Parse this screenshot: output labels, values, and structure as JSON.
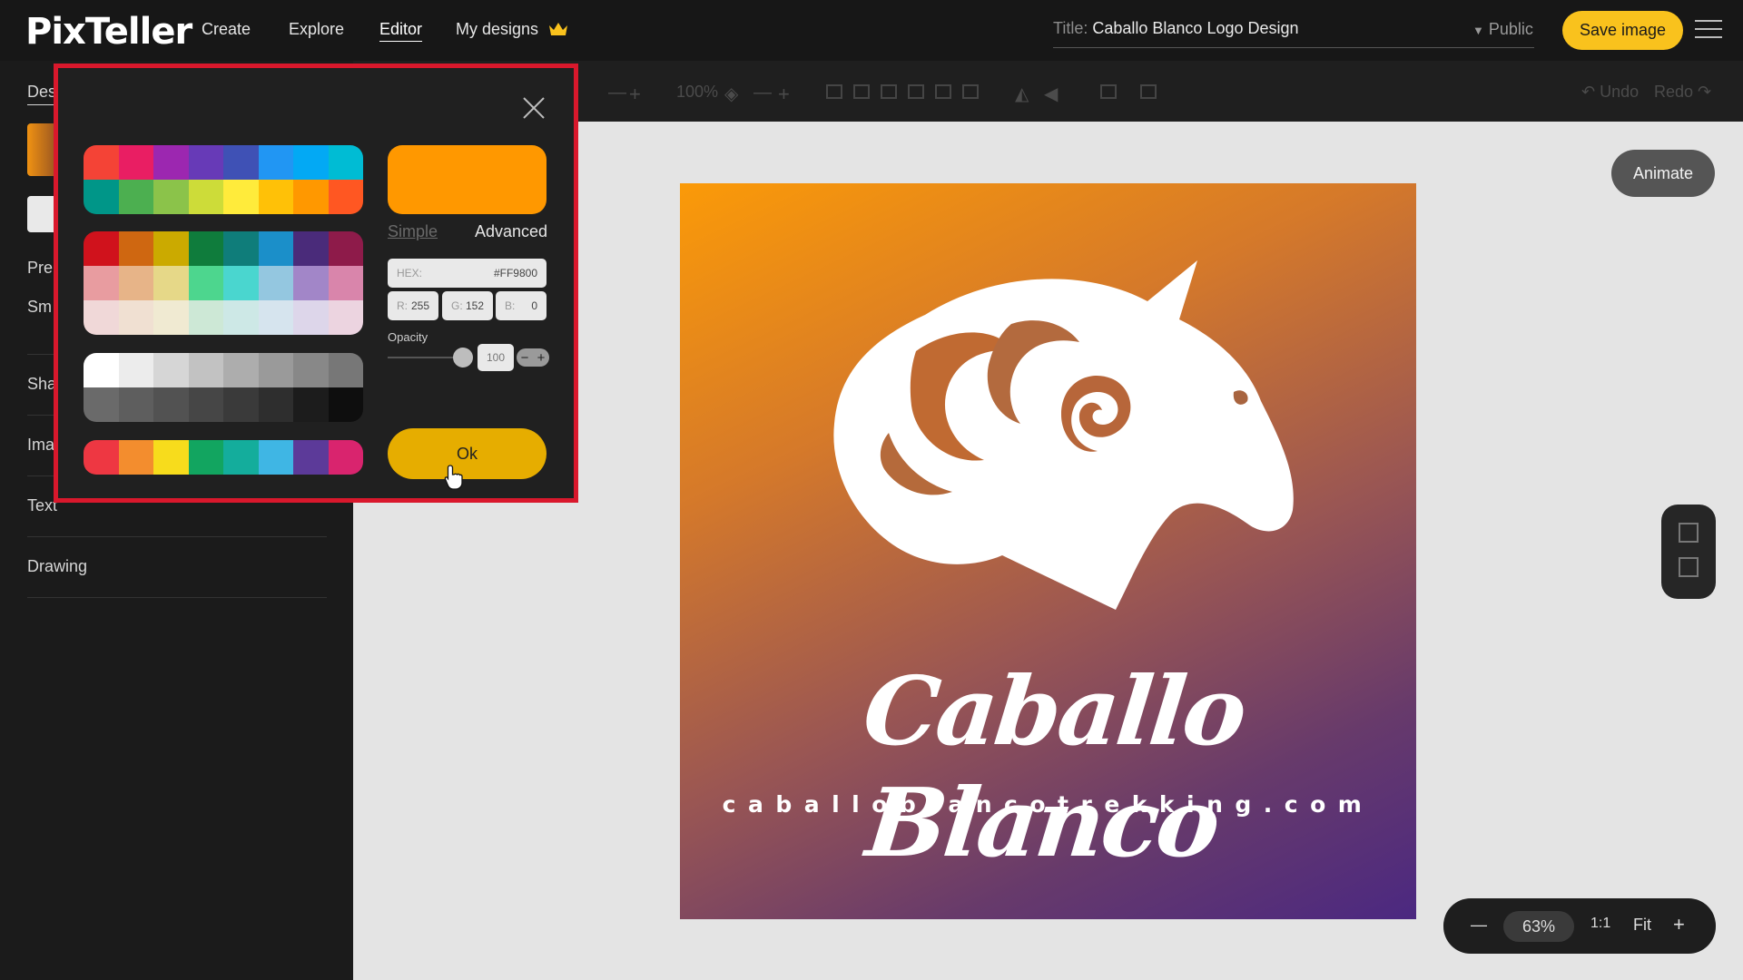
{
  "app": {
    "logo": "PixTeller"
  },
  "nav": {
    "create": "Create",
    "explore": "Explore",
    "editor": "Editor",
    "my_designs": "My designs"
  },
  "header": {
    "title_label": "Title:",
    "title_value": "Caballo Blanco Logo Design",
    "visibility": "Public",
    "save_label": "Save image"
  },
  "toolbar": {
    "zoom_percent": "100%",
    "undo": "Undo",
    "redo": "Redo"
  },
  "sidebar": {
    "tab_label": "Des",
    "items": [
      "Pre",
      "Sm",
      "Sha",
      "Ima",
      "Text",
      "Drawing"
    ]
  },
  "canvas": {
    "brand_name": "Caballo Blanco",
    "brand_url": "caballoblancotrekking.com",
    "gradient_start": "#fb9a08",
    "gradient_end": "#4b2881"
  },
  "animate_label": "Animate",
  "zoom": {
    "minus": "—",
    "value": "63%",
    "ratio": "1:1",
    "fit": "Fit",
    "plus": "+"
  },
  "color_dialog": {
    "rows_bright": [
      [
        "#f44336",
        "#e91e63",
        "#9c27b0",
        "#673ab7",
        "#3f51b5",
        "#2196f3",
        "#03a9f4",
        "#00bcd4"
      ],
      [
        "#009688",
        "#4caf50",
        "#8bc34a",
        "#cddc39",
        "#ffeb3b",
        "#ffc107",
        "#ff9800",
        "#ff5722"
      ]
    ],
    "rows_tones": [
      [
        "#d0121c",
        "#cf6711",
        "#cbaa00",
        "#0f7c3c",
        "#0f7d7a",
        "#1b8fc9",
        "#4a2b7a",
        "#8e1b4a"
      ],
      [
        "#e89ca0",
        "#e7b488",
        "#e6d888",
        "#4dd68e",
        "#4ad6cf",
        "#94c7e0",
        "#a286c8",
        "#d985ab"
      ],
      [
        "#f0d8d8",
        "#f0e0d2",
        "#f0ead2",
        "#cde8d6",
        "#cde8e6",
        "#d6e4ee",
        "#ddd6ea",
        "#ecd4e0"
      ]
    ],
    "rows_gray": [
      [
        "#ffffff",
        "#ececec",
        "#d6d6d6",
        "#c2c2c2",
        "#adadad",
        "#9a9a9a",
        "#888888",
        "#777777"
      ],
      [
        "#6a6a6a",
        "#5e5e5e",
        "#525252",
        "#464646",
        "#3a3a3a",
        "#2e2e2e",
        "#1c1c1c",
        "#0e0e0e"
      ]
    ],
    "rows_recent": [
      [
        "#ee3742",
        "#f38d2e",
        "#f7dc1c",
        "#12a560",
        "#14ad9c",
        "#3fb6e4",
        "#5c3a99",
        "#d9246e"
      ]
    ],
    "preview_color": "#ff9800",
    "tab_simple": "Simple",
    "tab_advanced": "Advanced",
    "hex_label": "HEX:",
    "hex_value": "#FF9800",
    "r_label": "R:",
    "r_value": "255",
    "g_label": "G:",
    "g_value": "152",
    "b_label": "B:",
    "b_value": "0",
    "opacity_label": "Opacity",
    "opacity_value": "100",
    "ok_label": "Ok"
  },
  "icons": [
    "crown-icon",
    "menu-icon",
    "close-icon",
    "cursor-icon",
    "undo-icon",
    "redo-icon",
    "add-page-icon",
    "duplicate-page-icon"
  ]
}
